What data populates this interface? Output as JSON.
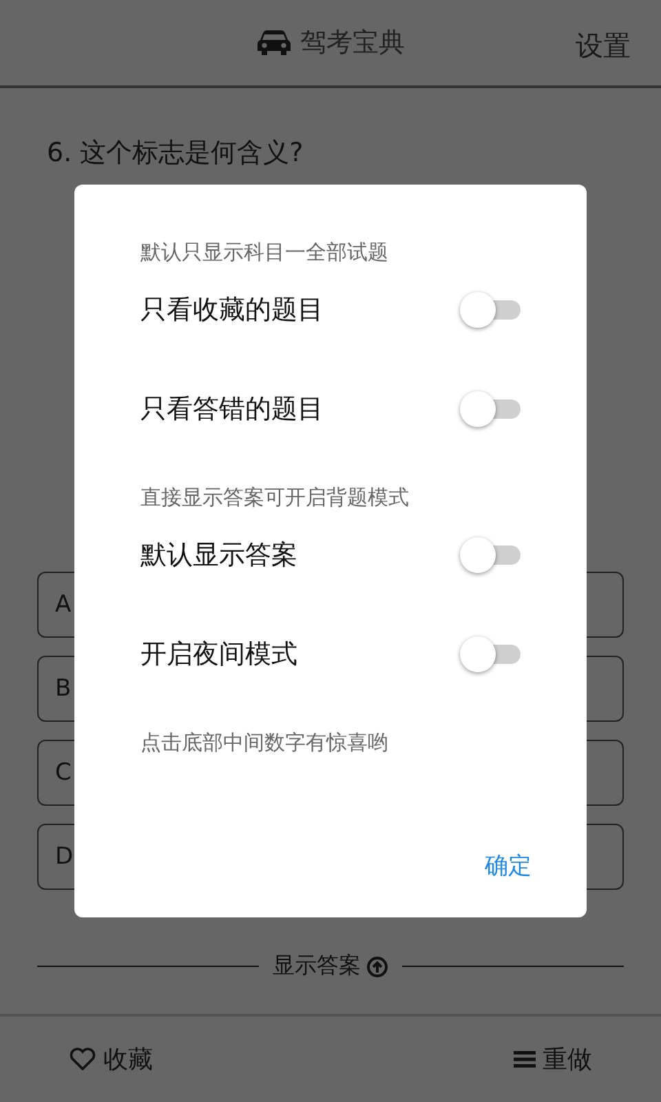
{
  "header": {
    "title": "驾考宝典",
    "action": "设置"
  },
  "question": "6. 这个标志是何含义?",
  "options": [
    {
      "letter": "A"
    },
    {
      "letter": "B"
    },
    {
      "letter": "C"
    },
    {
      "letter": "D"
    }
  ],
  "show_answer": "显示答案",
  "footer": {
    "favorite": "收藏",
    "redo": "重做"
  },
  "dialog": {
    "items": [
      {
        "kind": "note",
        "text": "默认只显示科目一全部试题"
      },
      {
        "kind": "switch",
        "label": "只看收藏的题目",
        "on": false
      },
      {
        "kind": "switch",
        "label": "只看答错的题目",
        "on": false
      },
      {
        "kind": "note",
        "text": "直接显示答案可开启背题模式"
      },
      {
        "kind": "switch",
        "label": "默认显示答案",
        "on": false
      },
      {
        "kind": "switch",
        "label": "开启夜间模式",
        "on": false
      },
      {
        "kind": "note",
        "text": "点击底部中间数字有惊喜哟"
      }
    ],
    "confirm": "确定"
  }
}
